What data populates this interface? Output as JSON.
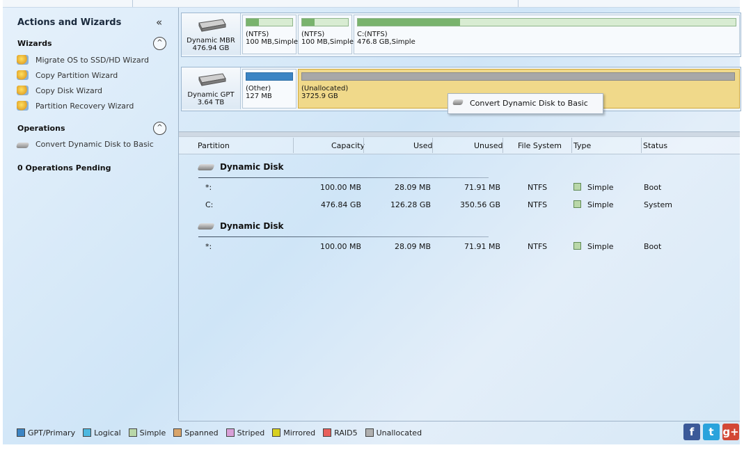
{
  "left_panel": {
    "title": "Actions and Wizards",
    "collapse_glyph": "«",
    "wizards_header": "Wizards",
    "wizards": [
      {
        "label": "Migrate OS to SSD/HD Wizard",
        "icon": "wizard-icon"
      },
      {
        "label": "Copy Partition Wizard",
        "icon": "wizard-icon"
      },
      {
        "label": "Copy Disk Wizard",
        "icon": "wizard-icon"
      },
      {
        "label": "Partition Recovery Wizard",
        "icon": "wizard-icon"
      }
    ],
    "operations_header": "Operations",
    "operations": [
      {
        "label": "Convert Dynamic Disk to Basic",
        "icon": "disk-icon"
      }
    ],
    "pending": "0 Operations Pending",
    "toggle_glyph": "^"
  },
  "disk_map": {
    "disk1": {
      "name": "Dynamic MBR",
      "size": "476.94 GB",
      "partitions": [
        {
          "l1": "(NTFS)",
          "l2": "100 MB,Simple",
          "used_fraction": 0.28
        },
        {
          "l1": "(NTFS)",
          "l2": "100 MB,Simple",
          "used_fraction": 0.28
        },
        {
          "l1": "C:(NTFS)",
          "l2": "476.8 GB,Simple",
          "used_fraction": 0.27
        }
      ]
    },
    "disk2": {
      "name": "Dynamic GPT",
      "size": "3.64 TB",
      "partitions": [
        {
          "l1": "(Other)",
          "l2": "127 MB",
          "bar_color": "#3c85c4"
        },
        {
          "l1": "(Unallocated)",
          "l2": "3725.9 GB",
          "bar_color": "#a8a8a8",
          "selected": true
        }
      ]
    }
  },
  "context_menu": {
    "item": "Convert Dynamic Disk to Basic",
    "icon": "disk-icon"
  },
  "table": {
    "columns": [
      "Partition",
      "Capacity",
      "Used",
      "Unused",
      "File System",
      "Type",
      "Status"
    ],
    "groups": [
      {
        "name": "Dynamic Disk",
        "rows": [
          {
            "partition": "*:",
            "capacity": "100.00 MB",
            "used": "28.09 MB",
            "unused": "71.91 MB",
            "fs": "NTFS",
            "type": "Simple",
            "status": "Boot"
          },
          {
            "partition": "C:",
            "capacity": "476.84 GB",
            "used": "126.28 GB",
            "unused": "350.56 GB",
            "fs": "NTFS",
            "type": "Simple",
            "status": "System"
          }
        ]
      },
      {
        "name": "Dynamic Disk",
        "rows": [
          {
            "partition": "*:",
            "capacity": "100.00 MB",
            "used": "28.09 MB",
            "unused": "71.91 MB",
            "fs": "NTFS",
            "type": "Simple",
            "status": "Boot"
          }
        ]
      }
    ]
  },
  "legend": [
    {
      "label": "GPT/Primary",
      "color": "#3c85c4"
    },
    {
      "label": "Logical",
      "color": "#4cb8e0"
    },
    {
      "label": "Simple",
      "color": "#b9d7a8"
    },
    {
      "label": "Spanned",
      "color": "#d8a46a"
    },
    {
      "label": "Striped",
      "color": "#d8a0d8"
    },
    {
      "label": "Mirrored",
      "color": "#d8d020"
    },
    {
      "label": "RAID5",
      "color": "#e8605c"
    },
    {
      "label": "Unallocated",
      "color": "#b0b0b0"
    }
  ],
  "social": [
    {
      "name": "facebook-icon",
      "glyph": "f",
      "color": "#3b5998"
    },
    {
      "name": "twitter-icon",
      "glyph": "t",
      "color": "#2aa3dc"
    },
    {
      "name": "google-plus-icon",
      "glyph": "g+",
      "color": "#d34836"
    }
  ]
}
